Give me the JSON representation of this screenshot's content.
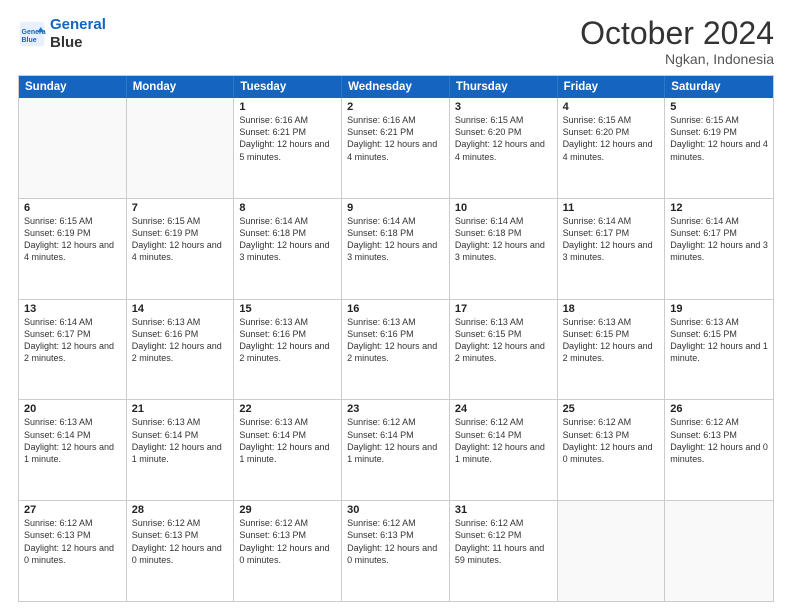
{
  "header": {
    "logo_line1": "General",
    "logo_line2": "Blue",
    "month": "October 2024",
    "location": "Ngkan, Indonesia"
  },
  "weekdays": [
    "Sunday",
    "Monday",
    "Tuesday",
    "Wednesday",
    "Thursday",
    "Friday",
    "Saturday"
  ],
  "rows": [
    [
      {
        "day": "",
        "sunrise": "",
        "sunset": "",
        "daylight": ""
      },
      {
        "day": "",
        "sunrise": "",
        "sunset": "",
        "daylight": ""
      },
      {
        "day": "1",
        "sunrise": "Sunrise: 6:16 AM",
        "sunset": "Sunset: 6:21 PM",
        "daylight": "Daylight: 12 hours and 5 minutes."
      },
      {
        "day": "2",
        "sunrise": "Sunrise: 6:16 AM",
        "sunset": "Sunset: 6:21 PM",
        "daylight": "Daylight: 12 hours and 4 minutes."
      },
      {
        "day": "3",
        "sunrise": "Sunrise: 6:15 AM",
        "sunset": "Sunset: 6:20 PM",
        "daylight": "Daylight: 12 hours and 4 minutes."
      },
      {
        "day": "4",
        "sunrise": "Sunrise: 6:15 AM",
        "sunset": "Sunset: 6:20 PM",
        "daylight": "Daylight: 12 hours and 4 minutes."
      },
      {
        "day": "5",
        "sunrise": "Sunrise: 6:15 AM",
        "sunset": "Sunset: 6:19 PM",
        "daylight": "Daylight: 12 hours and 4 minutes."
      }
    ],
    [
      {
        "day": "6",
        "sunrise": "Sunrise: 6:15 AM",
        "sunset": "Sunset: 6:19 PM",
        "daylight": "Daylight: 12 hours and 4 minutes."
      },
      {
        "day": "7",
        "sunrise": "Sunrise: 6:15 AM",
        "sunset": "Sunset: 6:19 PM",
        "daylight": "Daylight: 12 hours and 4 minutes."
      },
      {
        "day": "8",
        "sunrise": "Sunrise: 6:14 AM",
        "sunset": "Sunset: 6:18 PM",
        "daylight": "Daylight: 12 hours and 3 minutes."
      },
      {
        "day": "9",
        "sunrise": "Sunrise: 6:14 AM",
        "sunset": "Sunset: 6:18 PM",
        "daylight": "Daylight: 12 hours and 3 minutes."
      },
      {
        "day": "10",
        "sunrise": "Sunrise: 6:14 AM",
        "sunset": "Sunset: 6:18 PM",
        "daylight": "Daylight: 12 hours and 3 minutes."
      },
      {
        "day": "11",
        "sunrise": "Sunrise: 6:14 AM",
        "sunset": "Sunset: 6:17 PM",
        "daylight": "Daylight: 12 hours and 3 minutes."
      },
      {
        "day": "12",
        "sunrise": "Sunrise: 6:14 AM",
        "sunset": "Sunset: 6:17 PM",
        "daylight": "Daylight: 12 hours and 3 minutes."
      }
    ],
    [
      {
        "day": "13",
        "sunrise": "Sunrise: 6:14 AM",
        "sunset": "Sunset: 6:17 PM",
        "daylight": "Daylight: 12 hours and 2 minutes."
      },
      {
        "day": "14",
        "sunrise": "Sunrise: 6:13 AM",
        "sunset": "Sunset: 6:16 PM",
        "daylight": "Daylight: 12 hours and 2 minutes."
      },
      {
        "day": "15",
        "sunrise": "Sunrise: 6:13 AM",
        "sunset": "Sunset: 6:16 PM",
        "daylight": "Daylight: 12 hours and 2 minutes."
      },
      {
        "day": "16",
        "sunrise": "Sunrise: 6:13 AM",
        "sunset": "Sunset: 6:16 PM",
        "daylight": "Daylight: 12 hours and 2 minutes."
      },
      {
        "day": "17",
        "sunrise": "Sunrise: 6:13 AM",
        "sunset": "Sunset: 6:15 PM",
        "daylight": "Daylight: 12 hours and 2 minutes."
      },
      {
        "day": "18",
        "sunrise": "Sunrise: 6:13 AM",
        "sunset": "Sunset: 6:15 PM",
        "daylight": "Daylight: 12 hours and 2 minutes."
      },
      {
        "day": "19",
        "sunrise": "Sunrise: 6:13 AM",
        "sunset": "Sunset: 6:15 PM",
        "daylight": "Daylight: 12 hours and 1 minute."
      }
    ],
    [
      {
        "day": "20",
        "sunrise": "Sunrise: 6:13 AM",
        "sunset": "Sunset: 6:14 PM",
        "daylight": "Daylight: 12 hours and 1 minute."
      },
      {
        "day": "21",
        "sunrise": "Sunrise: 6:13 AM",
        "sunset": "Sunset: 6:14 PM",
        "daylight": "Daylight: 12 hours and 1 minute."
      },
      {
        "day": "22",
        "sunrise": "Sunrise: 6:13 AM",
        "sunset": "Sunset: 6:14 PM",
        "daylight": "Daylight: 12 hours and 1 minute."
      },
      {
        "day": "23",
        "sunrise": "Sunrise: 6:12 AM",
        "sunset": "Sunset: 6:14 PM",
        "daylight": "Daylight: 12 hours and 1 minute."
      },
      {
        "day": "24",
        "sunrise": "Sunrise: 6:12 AM",
        "sunset": "Sunset: 6:14 PM",
        "daylight": "Daylight: 12 hours and 1 minute."
      },
      {
        "day": "25",
        "sunrise": "Sunrise: 6:12 AM",
        "sunset": "Sunset: 6:13 PM",
        "daylight": "Daylight: 12 hours and 0 minutes."
      },
      {
        "day": "26",
        "sunrise": "Sunrise: 6:12 AM",
        "sunset": "Sunset: 6:13 PM",
        "daylight": "Daylight: 12 hours and 0 minutes."
      }
    ],
    [
      {
        "day": "27",
        "sunrise": "Sunrise: 6:12 AM",
        "sunset": "Sunset: 6:13 PM",
        "daylight": "Daylight: 12 hours and 0 minutes."
      },
      {
        "day": "28",
        "sunrise": "Sunrise: 6:12 AM",
        "sunset": "Sunset: 6:13 PM",
        "daylight": "Daylight: 12 hours and 0 minutes."
      },
      {
        "day": "29",
        "sunrise": "Sunrise: 6:12 AM",
        "sunset": "Sunset: 6:13 PM",
        "daylight": "Daylight: 12 hours and 0 minutes."
      },
      {
        "day": "30",
        "sunrise": "Sunrise: 6:12 AM",
        "sunset": "Sunset: 6:13 PM",
        "daylight": "Daylight: 12 hours and 0 minutes."
      },
      {
        "day": "31",
        "sunrise": "Sunrise: 6:12 AM",
        "sunset": "Sunset: 6:12 PM",
        "daylight": "Daylight: 11 hours and 59 minutes."
      },
      {
        "day": "",
        "sunrise": "",
        "sunset": "",
        "daylight": ""
      },
      {
        "day": "",
        "sunrise": "",
        "sunset": "",
        "daylight": ""
      }
    ]
  ]
}
